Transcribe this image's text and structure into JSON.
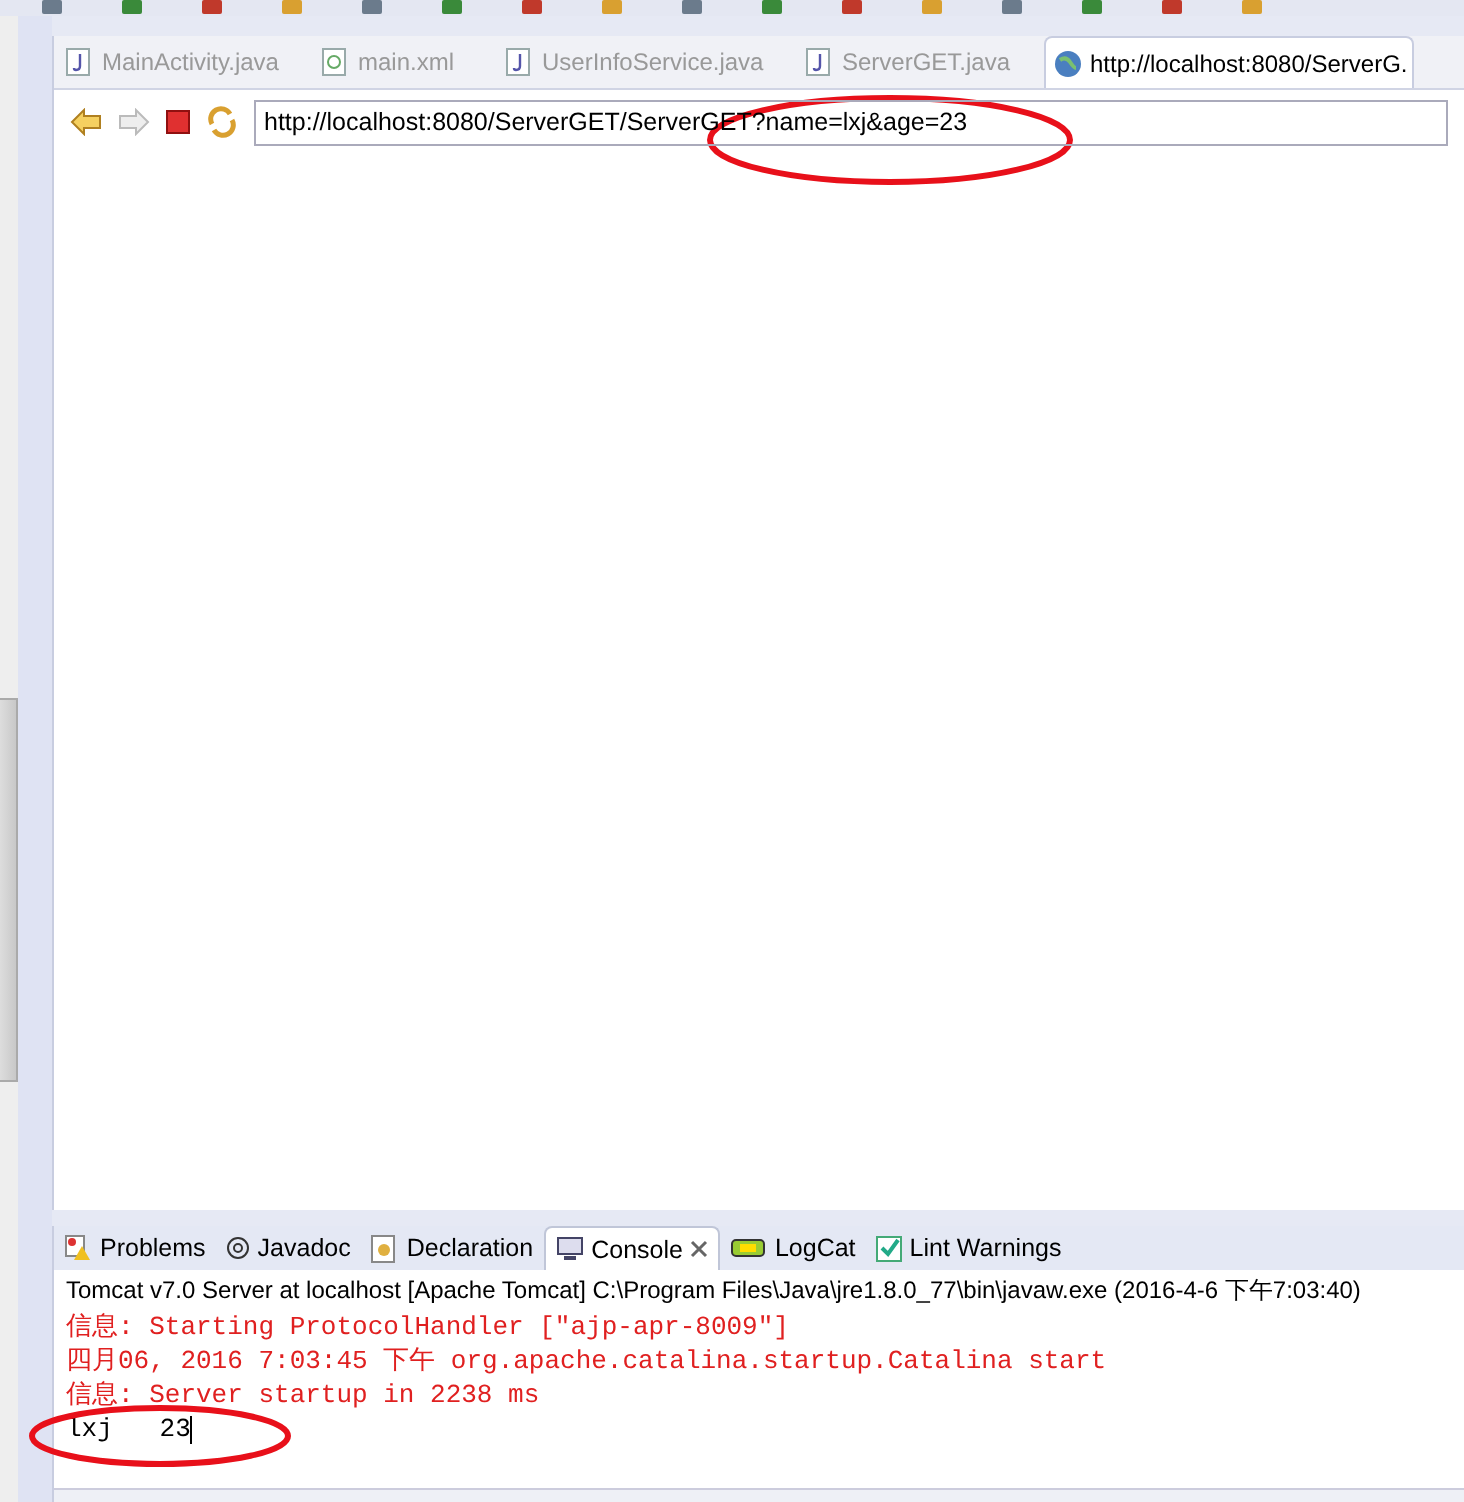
{
  "editor_tabs": [
    {
      "label": "MainActivity.java",
      "kind": "java",
      "selected": false
    },
    {
      "label": "main.xml",
      "kind": "xml",
      "selected": false
    },
    {
      "label": "UserInfoService.java",
      "kind": "java",
      "selected": false
    },
    {
      "label": "ServerGET.java",
      "kind": "java",
      "selected": false
    },
    {
      "label": "http://localhost:8080/ServerG.",
      "kind": "web",
      "selected": true
    }
  ],
  "browser": {
    "url": "http://localhost:8080/ServerGET/ServerGET?name=lxj&age=23"
  },
  "view_tabs": [
    {
      "label": "Problems",
      "kind": "problems",
      "selected": false
    },
    {
      "label": "Javadoc",
      "kind": "javadoc",
      "selected": false
    },
    {
      "label": "Declaration",
      "kind": "declaration",
      "selected": false
    },
    {
      "label": "Console",
      "kind": "console",
      "selected": true,
      "closable": true
    },
    {
      "label": "LogCat",
      "kind": "logcat",
      "selected": false
    },
    {
      "label": "Lint Warnings",
      "kind": "lint",
      "selected": false
    }
  ],
  "console": {
    "header": "Tomcat v7.0 Server at localhost [Apache Tomcat] C:\\Program Files\\Java\\jre1.8.0_77\\bin\\javaw.exe (2016-4-6 下午7:03:40)",
    "lines": [
      {
        "kind": "stderr",
        "text": "信息: Starting ProtocolHandler [\"ajp-apr-8009\"]"
      },
      {
        "kind": "stderr",
        "text": "四月06, 2016 7:03:45 下午 org.apache.catalina.startup.Catalina start"
      },
      {
        "kind": "stderr",
        "text": "信息: Server startup in 2238 ms"
      },
      {
        "kind": "stdout",
        "text": "lxj   23",
        "cursor": true
      }
    ]
  }
}
